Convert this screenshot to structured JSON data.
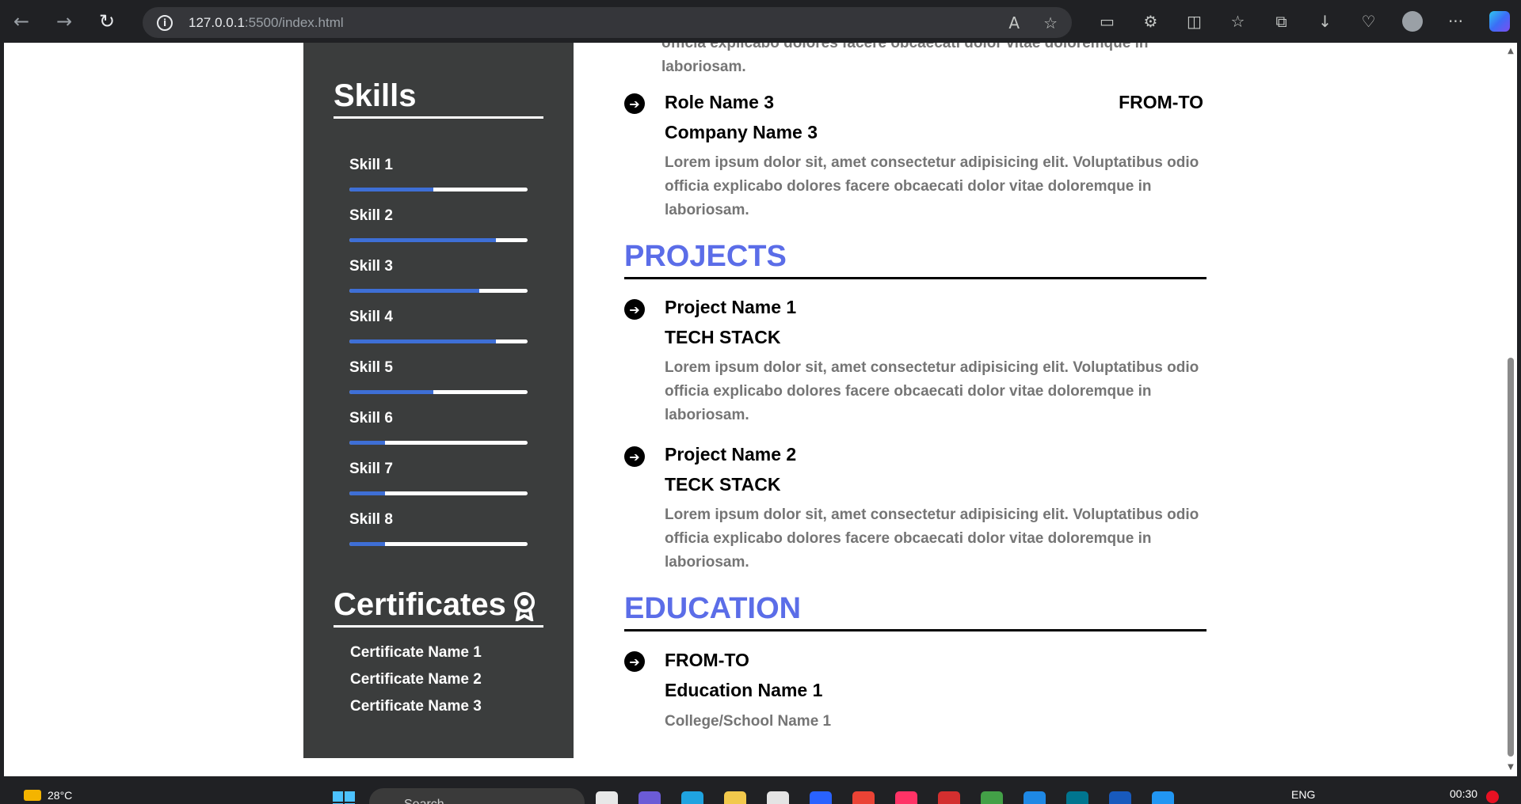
{
  "browser": {
    "url_host": "127.0.0.1",
    "url_rest": ":5500/index.html"
  },
  "sidebar": {
    "skills_title": "Skills",
    "skills": [
      {
        "name": "Skill 1",
        "level": 0.47
      },
      {
        "name": "Skill 2",
        "level": 0.82
      },
      {
        "name": "Skill 3",
        "level": 0.73
      },
      {
        "name": "Skill 4",
        "level": 0.82
      },
      {
        "name": "Skill 5",
        "level": 0.47
      },
      {
        "name": "Skill 6",
        "level": 0.2
      },
      {
        "name": "Skill 7",
        "level": 0.2
      },
      {
        "name": "Skill 8",
        "level": 0.2
      }
    ],
    "certificates_title": "Certificates",
    "certificates": [
      "Certificate Name 1",
      "Certificate Name 2",
      "Certificate Name 3"
    ]
  },
  "main": {
    "partial_text": "officia explicabo dolores facere obcaecati dolor vitae doloremque in laboriosam.",
    "experience": {
      "role": "Role Name 3",
      "period": "FROM-TO",
      "company": "Company Name 3",
      "description": "Lorem ipsum dolor sit, amet consectetur adipisicing elit. Voluptatibus odio officia explicabo dolores facere obcaecati dolor vitae doloremque in laboriosam."
    },
    "projects_title": "PROJECTS",
    "projects": [
      {
        "name": "Project Name 1",
        "stack": "TECH STACK",
        "description": "Lorem ipsum dolor sit, amet consectetur adipisicing elit. Voluptatibus odio officia explicabo dolores facere obcaecati dolor vitae doloremque in laboriosam."
      },
      {
        "name": "Project Name 2",
        "stack": "TECK STACK",
        "description": "Lorem ipsum dolor sit, amet consectetur adipisicing elit. Voluptatibus odio officia explicabo dolores facere obcaecati dolor vitae doloremque in laboriosam."
      }
    ],
    "education_title": "EDUCATION",
    "education": {
      "period": "FROM-TO",
      "name": "Education Name 1",
      "school": "College/School Name 1"
    }
  },
  "taskbar": {
    "temperature": "28°C",
    "search_placeholder": "Search",
    "language": "ENG",
    "time": "00:30"
  },
  "colors": {
    "sidebar_bg": "#3b3d3d",
    "accent_heading": "#5b6de8",
    "skill_bar_fill": "#3e6fd6",
    "muted_text": "#757575"
  }
}
